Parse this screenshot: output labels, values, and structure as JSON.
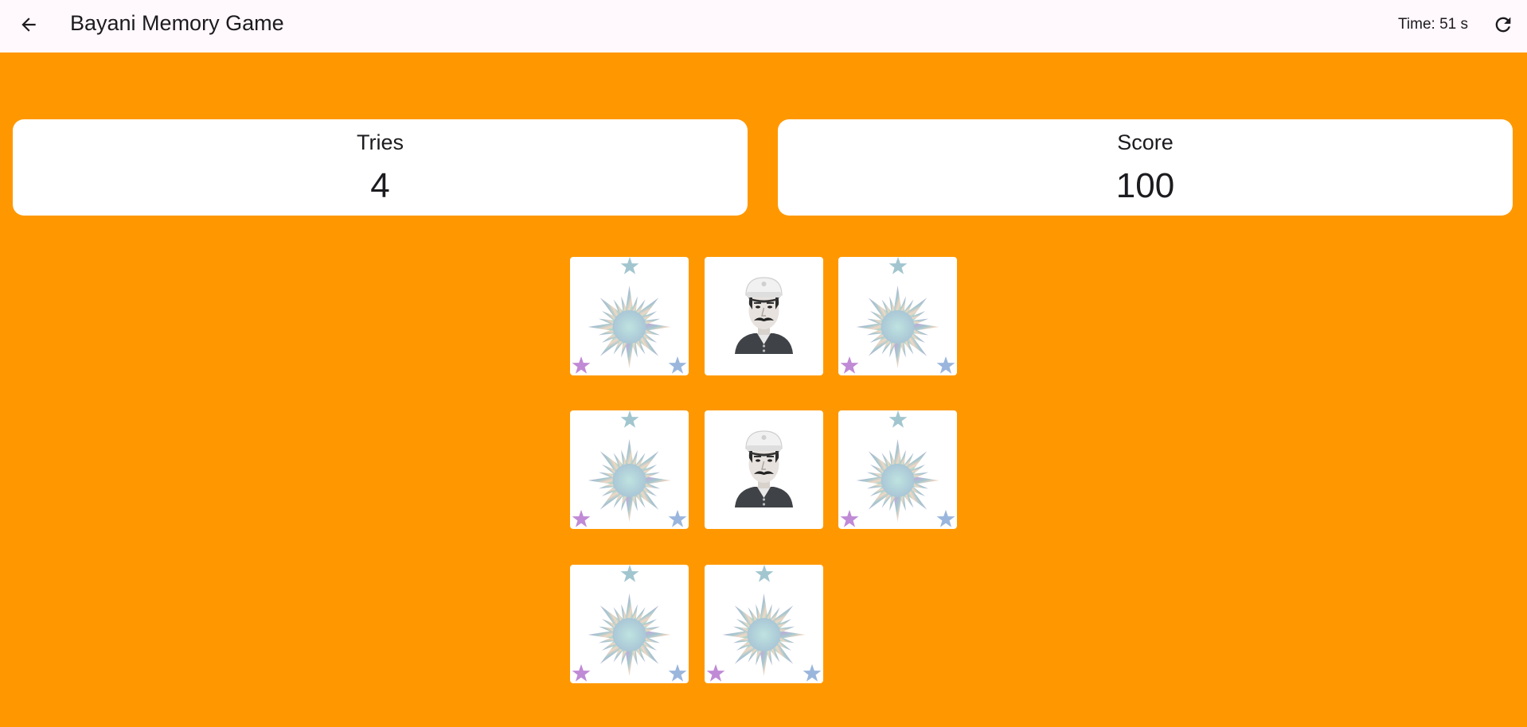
{
  "app_bar": {
    "title": "Bayani Memory Game",
    "timer": "Time: 51 s",
    "back_icon": "arrow-back-icon",
    "refresh_icon": "refresh-icon"
  },
  "stats": {
    "tries_label": "Tries",
    "tries_value": "4",
    "score_label": "Score",
    "score_value": "100"
  },
  "colors": {
    "background": "#ff9800",
    "app_bar": "#fff8fc",
    "card": "#ffffff"
  },
  "board": {
    "cards": [
      {
        "face": "card-back-sun-icon"
      },
      {
        "face": "hero-portrait-icon",
        "revealed": true
      },
      {
        "face": "card-back-sun-icon"
      },
      {
        "face": "card-back-sun-icon"
      },
      {
        "face": "hero-portrait-icon",
        "revealed": true
      },
      {
        "face": "card-back-sun-icon"
      },
      {
        "face": "card-back-sun-icon"
      },
      {
        "face": "card-back-sun-icon"
      }
    ]
  }
}
